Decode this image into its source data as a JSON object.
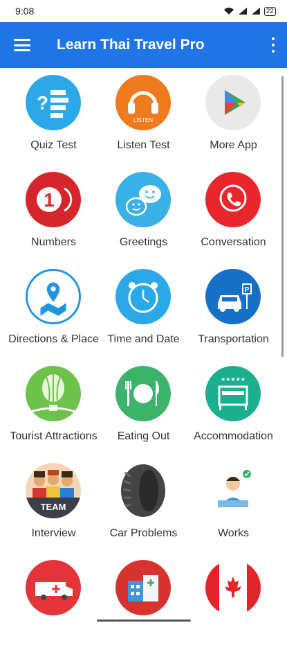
{
  "status": {
    "time": "9:08",
    "battery": "22"
  },
  "app": {
    "title": "Learn Thai Travel Pro"
  },
  "tiles": [
    {
      "label": "Quiz Test",
      "icon": "quiz-icon",
      "color": "#2aa8e8"
    },
    {
      "label": "Listen Test",
      "icon": "headphones-icon",
      "color": "#f07a1e",
      "badge": "LISTEN"
    },
    {
      "label": "More App",
      "icon": "play-store-icon",
      "color": "#e9e9e9"
    },
    {
      "label": "Numbers",
      "icon": "number-one-icon",
      "color": "#d7262b",
      "glyph": "1"
    },
    {
      "label": "Greetings",
      "icon": "smiley-chat-icon",
      "color": "#3ab0e6"
    },
    {
      "label": "Conversation",
      "icon": "phone-call-icon",
      "color": "#e8262b"
    },
    {
      "label": "Directions & Place",
      "icon": "map-pin-icon",
      "color": "#2196e0"
    },
    {
      "label": "Time and Date",
      "icon": "alarm-clock-icon",
      "color": "#2aa8e8"
    },
    {
      "label": "Transportation",
      "icon": "car-parking-icon",
      "color": "#1670c8",
      "badge": "P"
    },
    {
      "label": "Tourist Attractions",
      "icon": "hot-air-balloon-icon",
      "color": "#6cc24a"
    },
    {
      "label": "Eating Out",
      "icon": "plate-cutlery-icon",
      "color": "#3bb36a"
    },
    {
      "label": "Accommodation",
      "icon": "hotel-bed-icon",
      "color": "#1ab08f",
      "badge": "★★★★★"
    },
    {
      "label": "Interview",
      "icon": "team-icon",
      "color": "#3a3f4a",
      "badge": "TEAM"
    },
    {
      "label": "Car Problems",
      "icon": "tire-icon",
      "color": "#444444"
    },
    {
      "label": "Works",
      "icon": "worker-laptop-icon",
      "color": "#ffffff"
    },
    {
      "label": "",
      "icon": "ambulance-icon",
      "color": "#e5333a"
    },
    {
      "label": "",
      "icon": "hospital-icon",
      "color": "#d8322e"
    },
    {
      "label": "",
      "icon": "canada-flag-icon",
      "color": "#e0262b"
    }
  ]
}
